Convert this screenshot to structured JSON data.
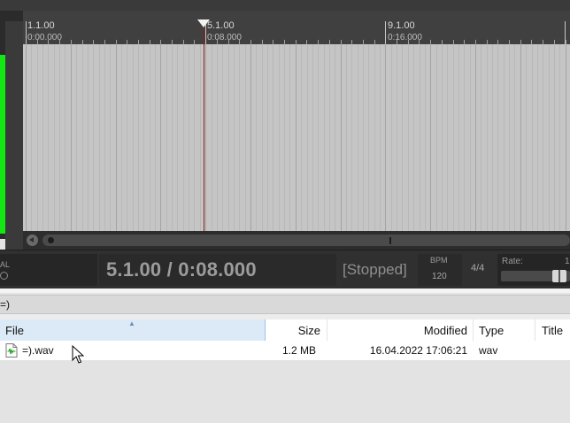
{
  "ruler": {
    "marks": [
      {
        "bar": "1.1.00",
        "time": "0:00.000"
      },
      {
        "bar": "5.1.00",
        "time": "0:08.000"
      },
      {
        "bar": "9.1.00",
        "time": "0:16.000"
      }
    ]
  },
  "transport": {
    "left_label": "AL",
    "position": "5.1.00 / 0:08.000",
    "status": "[Stopped]",
    "bpm_label": "BPM",
    "bpm_value": "120",
    "time_signature": "4/4",
    "rate_label": "Rate:",
    "rate_value": "1"
  },
  "explorer": {
    "path": "=)",
    "columns": {
      "file": "File",
      "size": "Size",
      "modified": "Modified",
      "type": "Type",
      "title": "Title"
    },
    "sorted_column": "File",
    "rows": [
      {
        "file": "=).wav",
        "size": "1.2 MB",
        "modified": "16.04.2022 17:06:21",
        "type": "wav",
        "icon": "audio-file-icon"
      }
    ]
  },
  "colors": {
    "meter": "#14e814",
    "playhead": "#8a1c1c",
    "selected_header": "#dceaf8"
  }
}
